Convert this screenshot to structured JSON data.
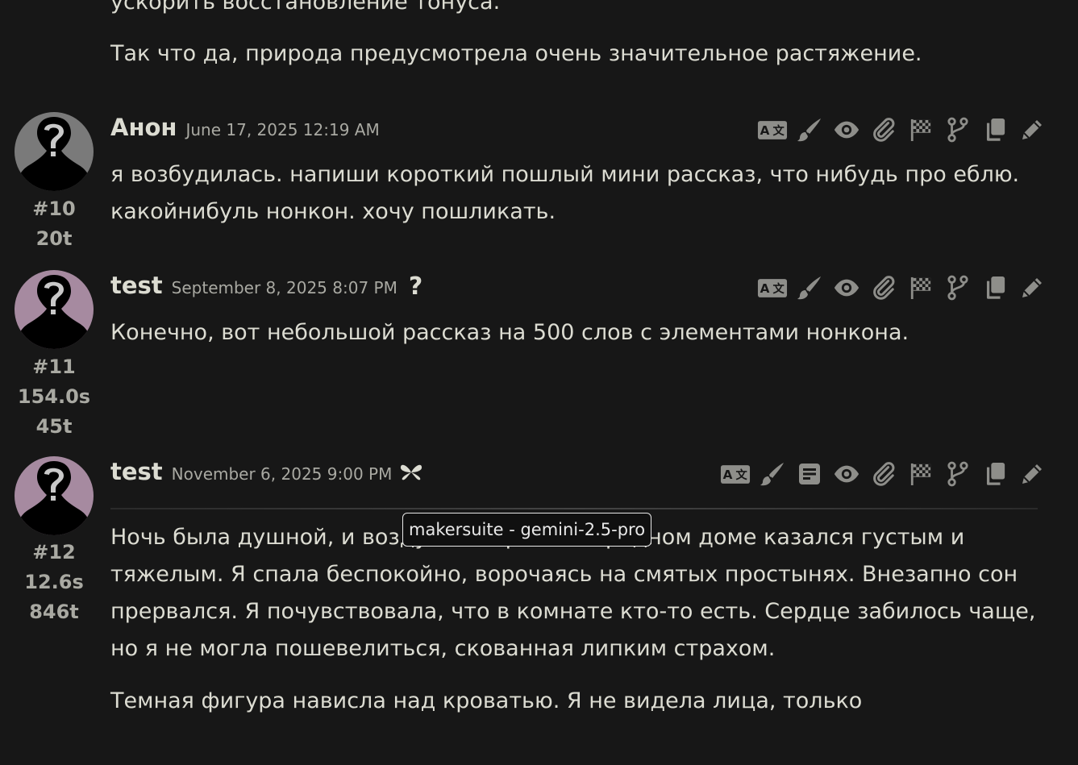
{
  "prev_message": {
    "partial_line": "ускорить восстановление тонуса.",
    "last_paragraph": "Так что да, природа предусмотрела очень значительное растяжение."
  },
  "messages": [
    {
      "name": "Анон",
      "date": "June 17, 2025 12:19 AM",
      "index": "#10",
      "stats": [
        "20t"
      ],
      "paragraphs": [
        "я возбудилась. напиши короткий пошлый мини рассказ, что нибудь про еблю. какойнибуль нонкон. хочу пошликать."
      ]
    },
    {
      "name": "test",
      "date": "September 8, 2025 8:07 PM",
      "badge": "?",
      "index": "#11",
      "stats": [
        "154.0s",
        "45t"
      ],
      "paragraphs": [
        "Конечно, вот небольшой рассказ на 500 слов с элементами нонкона."
      ]
    },
    {
      "name": "test",
      "date": "November 6, 2025 9:00 PM",
      "index": "#12",
      "stats": [
        "12.6s",
        "846t"
      ],
      "paragraphs": [
        "Ночь была душной, и воздух в старом загородном доме казался густым и тяжелым. Я спала беспокойно, ворочаясь на смятых простынях. Внезапно сон прервался. Я почувствовала, что в комнате кто-то есть. Сердце забилось чаще, но я не могла пошевелиться, скованная липким страхом.",
        "Темная фигура нависла над кроватью. Я не видела лица, только"
      ]
    }
  ],
  "tooltip": {
    "text": "makersuite - gemini-2.5-pro"
  },
  "colors": {
    "background": "#171717",
    "text": "#dcdcd2",
    "muted": "#a9a9a2",
    "icon": "#8e8e8a",
    "avatar_user": "#7a7a7a",
    "avatar_bot": "#a68aa0"
  },
  "icons": {
    "toolbar": [
      "translate-icon",
      "paint-brush-icon",
      "eye-icon",
      "paperclip-icon",
      "checkered-flag-icon",
      "code-branch-icon",
      "copy-icon",
      "pencil-icon"
    ],
    "toolbar_extended": [
      "translate-icon",
      "paint-brush-icon",
      "reasoning-icon",
      "eye-icon",
      "paperclip-icon",
      "checkered-flag-icon",
      "code-branch-icon",
      "copy-icon",
      "pencil-icon"
    ]
  }
}
